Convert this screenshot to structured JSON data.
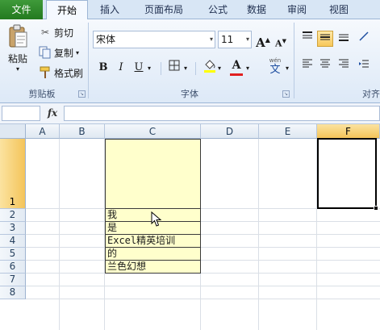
{
  "ribbon_tabs": [
    "文件",
    "开始",
    "插入",
    "页面布局",
    "公式",
    "数据",
    "审阅",
    "视图"
  ],
  "clipboard": {
    "paste_label": "粘贴",
    "cut_label": "剪切",
    "copy_label": "复制",
    "format_painter_label": "格式刷",
    "group_label": "剪贴板"
  },
  "font": {
    "name": "宋体",
    "size": "11",
    "bold": "B",
    "italic": "I",
    "underline": "U",
    "grow": "A",
    "shrink": "A",
    "font_color": "A",
    "phonetic": "wén",
    "phonetic_char": "文",
    "group_label": "字体"
  },
  "alignment": {
    "group_label": "对齐"
  },
  "formula_bar": {
    "fx": "fx",
    "name_box": "",
    "content": ""
  },
  "columns": [
    "A",
    "B",
    "C",
    "D",
    "E",
    "F"
  ],
  "selected_column": "F",
  "rows": [
    "1",
    "2",
    "3",
    "4",
    "5",
    "6",
    "7",
    "8"
  ],
  "selected_row": "1",
  "cells_C": [
    "",
    "我",
    "是",
    "Excel精英培训",
    "的",
    "兰色幻想"
  ],
  "colors": {
    "file_tab": "#2f8a2b",
    "cell_fill": "#ffffcc",
    "header_selected": "#f4c45a",
    "font_color_bar": "#e02020"
  }
}
